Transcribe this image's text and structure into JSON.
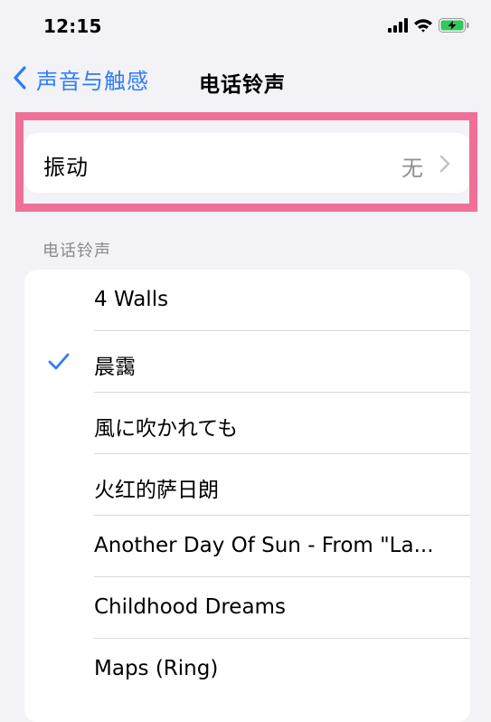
{
  "status_bar": {
    "time": "12:15",
    "icons": [
      "signal-icon",
      "wifi-icon",
      "battery-charging-icon"
    ]
  },
  "nav": {
    "back_label": "声音与触感",
    "title": "电话铃声"
  },
  "vibration": {
    "label": "振动",
    "value": "无"
  },
  "section": {
    "header": "电话铃声"
  },
  "ringtones": [
    {
      "label": "4 Walls",
      "selected": false
    },
    {
      "label": "晨靄",
      "selected": true
    },
    {
      "label": "風に吹かれても",
      "selected": false
    },
    {
      "label": "火红的萨日朗",
      "selected": false
    },
    {
      "label": "Another Day Of Sun - From \"La...",
      "selected": false
    },
    {
      "label": "Childhood Dreams",
      "selected": false
    },
    {
      "label": "Maps (Ring)",
      "selected": false
    }
  ],
  "colors": {
    "accent": "#2f7cf6",
    "highlight": "#ee6f98",
    "background": "#f2f2f7",
    "battery": "#34c759"
  }
}
